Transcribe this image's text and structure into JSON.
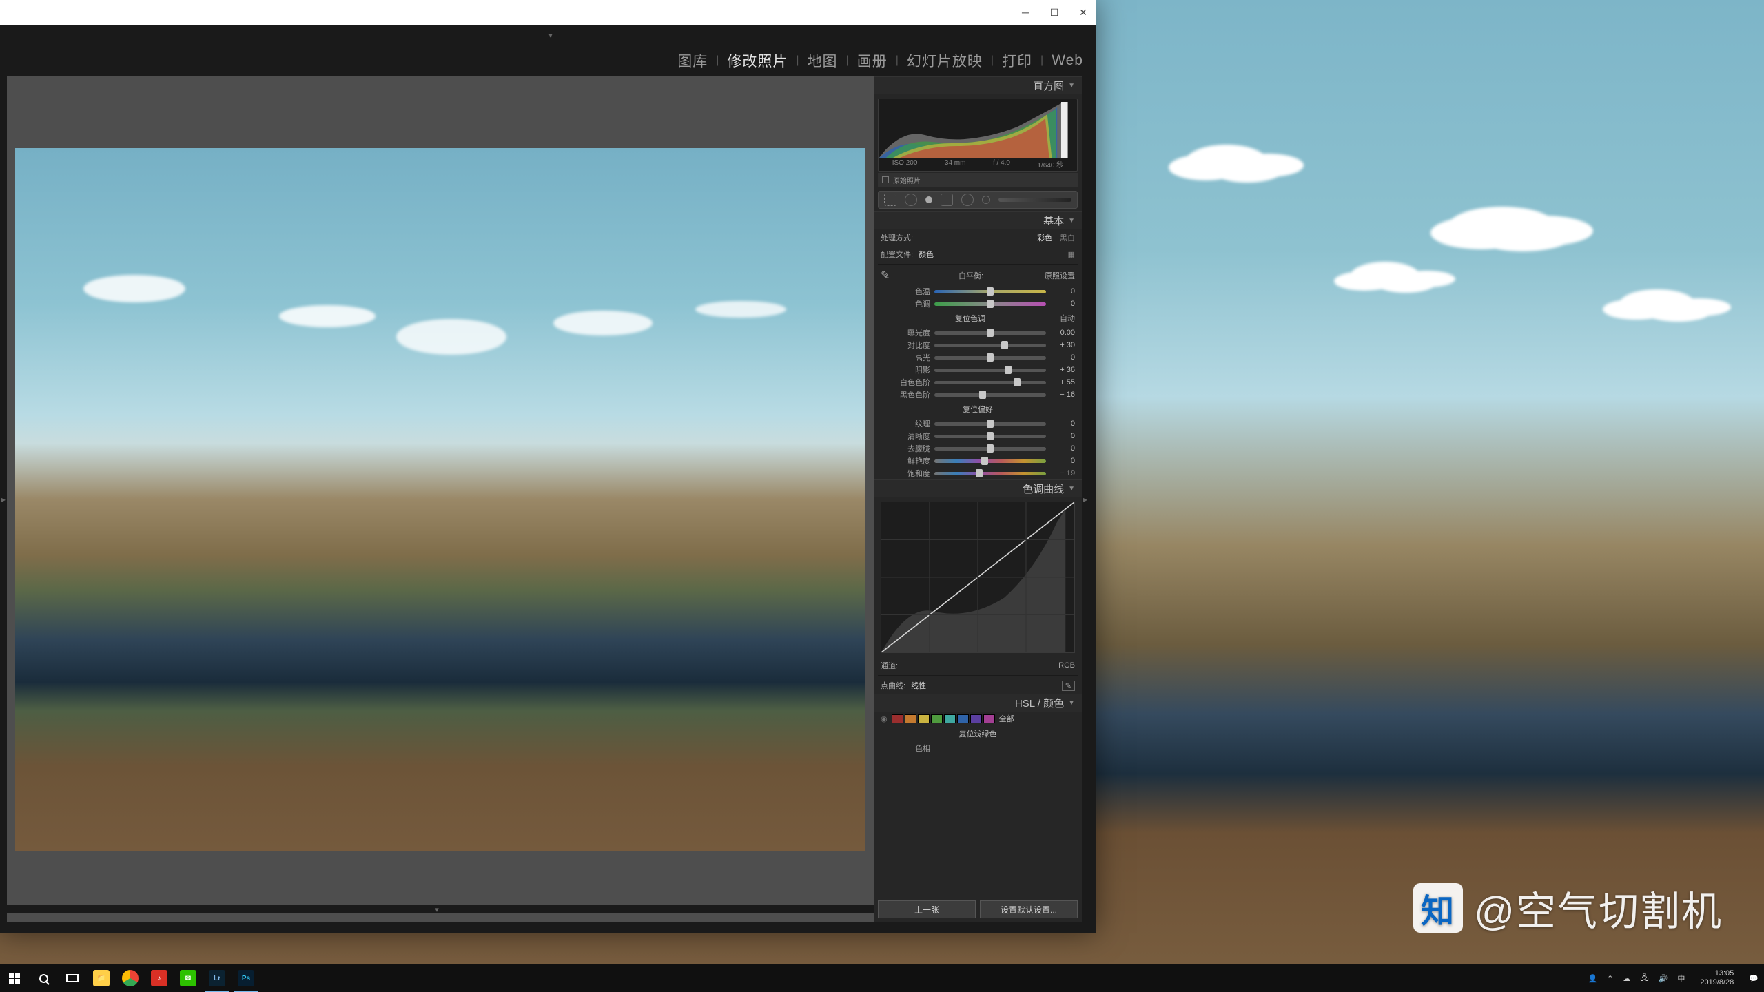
{
  "modules": [
    "图库",
    "修改照片",
    "地图",
    "画册",
    "幻灯片放映",
    "打印",
    "Web"
  ],
  "active_module": "修改照片",
  "panel": {
    "histogram_title": "直方图",
    "exif": {
      "iso": "ISO 200",
      "focal": "34 mm",
      "aperture": "f / 4.0",
      "shutter": "1/640 秒"
    },
    "meta_label": "原始照片",
    "basic_title": "基本",
    "treatment": {
      "label": "处理方式:",
      "color": "彩色",
      "bw": "黑白"
    },
    "profile": {
      "label": "配置文件:",
      "value": "颜色"
    },
    "wb": {
      "label": "白平衡:",
      "value": "原照设置"
    },
    "sliders_wb": [
      {
        "label": "色温",
        "val": "0",
        "pos": 50,
        "style": "temp"
      },
      {
        "label": "色调",
        "val": "0",
        "pos": 50,
        "style": "tint"
      }
    ],
    "tone_head": "复位色调",
    "auto": "自动",
    "sliders_tone": [
      {
        "label": "曝光度",
        "val": "0.00",
        "pos": 50
      },
      {
        "label": "对比度",
        "val": "+ 30",
        "pos": 63
      },
      {
        "label": "高光",
        "val": "0",
        "pos": 50
      },
      {
        "label": "阴影",
        "val": "+ 36",
        "pos": 66
      },
      {
        "label": "白色色阶",
        "val": "+ 55",
        "pos": 74
      },
      {
        "label": "黑色色阶",
        "val": "− 16",
        "pos": 43
      }
    ],
    "presence_head": "复位偏好",
    "sliders_presence": [
      {
        "label": "纹理",
        "val": "0",
        "pos": 50
      },
      {
        "label": "清晰度",
        "val": "0",
        "pos": 50
      },
      {
        "label": "去朦胧",
        "val": "0",
        "pos": 50
      },
      {
        "label": "鲜艳度",
        "val": "0",
        "pos": 45,
        "style": "sat"
      },
      {
        "label": "饱和度",
        "val": "− 19",
        "pos": 40,
        "style": "sat"
      }
    ],
    "curve_title": "色调曲线",
    "curve_channel_lbl": "通道:",
    "curve_channel": "RGB",
    "curve_point_lbl": "点曲线:",
    "curve_point": "线性",
    "hsl_title": "HSL / 颜色",
    "hsl_all": "全部",
    "hsl_head": "复位浅绿色",
    "hsl_hue": "色相",
    "swatches": [
      "#9a2e2e",
      "#c47a2f",
      "#c9b340",
      "#4f9b3e",
      "#3fa8a0",
      "#2f63a8",
      "#5b3fa0",
      "#a33f93"
    ]
  },
  "footer": {
    "prev": "上一张",
    "defaults": "设置默认设置..."
  },
  "watermark": "@空气切割机",
  "zhihu": "知",
  "taskbar": {
    "time": "13:05",
    "date": "2019/8/28",
    "ime": "中"
  }
}
